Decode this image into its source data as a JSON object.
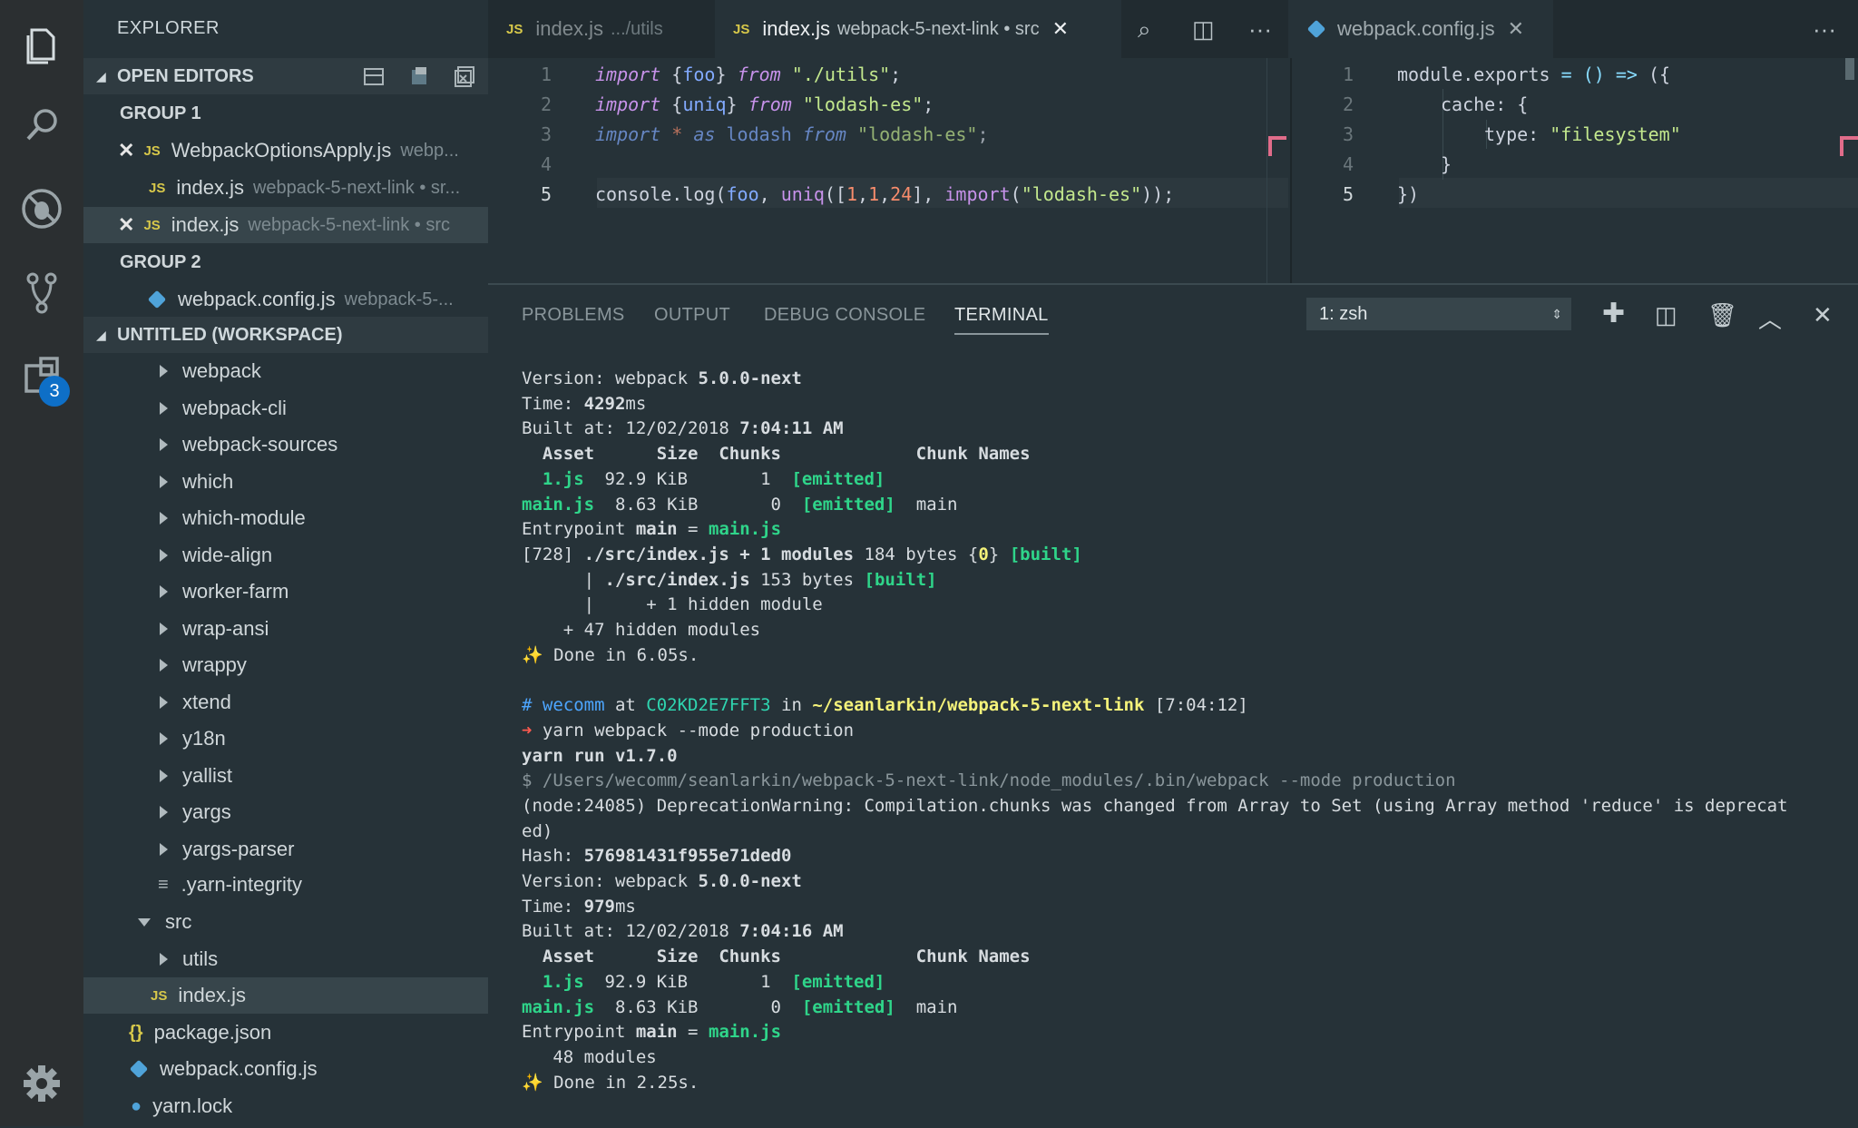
{
  "activity": {
    "badge": "3"
  },
  "sidebar": {
    "title": "EXPLORER",
    "open_editors_label": "OPEN EDITORS",
    "group1": "GROUP 1",
    "group2": "GROUP 2",
    "open_editors": [
      {
        "name": "WebpackOptionsApply.js",
        "desc": "webp..."
      },
      {
        "name": "index.js",
        "desc": "webpack-5-next-link • sr..."
      },
      {
        "name": "index.js",
        "desc": "webpack-5-next-link • src"
      },
      {
        "name": "webpack.config.js",
        "desc": "webpack-5-..."
      }
    ],
    "workspace_label": "UNTITLED (WORKSPACE)",
    "tree": [
      "webpack",
      "webpack-cli",
      "webpack-sources",
      "which",
      "which-module",
      "wide-align",
      "worker-farm",
      "wrap-ansi",
      "wrappy",
      "xtend",
      "y18n",
      "yallist",
      "yargs",
      "yargs-parser"
    ],
    "yarn_integrity": ".yarn-integrity",
    "src": "src",
    "utils": "utils",
    "index": "index.js",
    "package_json": "package.json",
    "webpack_config": "webpack.config.js",
    "yarn_lock": "yarn.lock"
  },
  "tabs": {
    "tab1_name": "index.js",
    "tab1_desc": ".../utils",
    "tab2_name": "index.js",
    "tab2_desc": "webpack-5-next-link • src",
    "tab3_name": "webpack.config.js"
  },
  "editor1": {
    "line_numbers": [
      "1",
      "2",
      "3",
      "4",
      "5"
    ],
    "l1": {
      "kw1": "import",
      "p1": " {",
      "v": "foo",
      "p2": "} ",
      "kw2": "from",
      "s": " \"./utils\"",
      "end": ";"
    },
    "l2": {
      "kw1": "import",
      "p1": " {",
      "v": "uniq",
      "p2": "} ",
      "kw2": "from",
      "s": " \"lodash-es\"",
      "end": ";"
    },
    "l3": {
      "kw1": "import",
      "op": " * ",
      "kw2": "as",
      "v": " lodash ",
      "kw3": "from",
      "s": " \"lodash-es\"",
      "end": ";"
    },
    "l5": {
      "a": "console.log(",
      "foo": "foo",
      "c1": ", ",
      "uniq": "uniq",
      "b1": "([",
      "n1": "1",
      "c2": ",",
      "n2": "1",
      "c3": ",",
      "n3": "24",
      "b2": "], ",
      "imp": "import",
      "b3": "(",
      "s": "\"lodash-es\"",
      "b4": "));"
    }
  },
  "editor2": {
    "line_numbers": [
      "1",
      "2",
      "3",
      "4",
      "5"
    ],
    "l1": {
      "a": "module.exports",
      "op": " = () => ",
      "b": "({"
    },
    "l2": "cache: {",
    "l3": {
      "k": "type: ",
      "s": "\"filesystem\""
    },
    "l4": "}",
    "l5": "})"
  },
  "panel": {
    "tabs": [
      "PROBLEMS",
      "OUTPUT",
      "DEBUG CONSOLE",
      "TERMINAL"
    ],
    "terminal_select": "1: zsh"
  },
  "terminal": {
    "version_label": "Version: webpack ",
    "version": "5.0.0-next",
    "time_label": "Time: ",
    "time1": "4292",
    "ms": "ms",
    "built1_label": "Built at: 12/02/2018 ",
    "built1": "7:04:11 AM",
    "asset_header": "  Asset      Size  Chunks             Chunk Names",
    "r1_name": "  1.js",
    "r1_rest": "  92.9 KiB       1  ",
    "emitted": "[emitted]",
    "r2_name": "main.js",
    "r2_rest": "  8.63 KiB       0  ",
    "r2_chunk": "  main",
    "entry_label": "Entrypoint ",
    "entry_main": "main",
    "entry_eq": " = ",
    "entry_file": "main.js",
    "m1a": "[728] ",
    "m1b": "./src/index.js + 1 modules",
    "m1c": " 184 bytes {",
    "m1d": "0",
    "m1e": "} ",
    "built_tag": "[built]",
    "m2a": "      | ",
    "m2b": "./src/index.js",
    "m2c": " 153 bytes ",
    "m3": "      |     + 1 hidden module",
    "m4": "    + 47 hidden modules",
    "done1": " Done in 6.05s.",
    "p_hash": "# ",
    "p_user": "wecomm",
    "p_at": " at ",
    "p_host": "C02KD2E7FFT3",
    "p_in": " in ",
    "p_path": "~/seanlarkin/webpack-5-next-link",
    "p_time": " [7:04:12]",
    "arrow": "➜ ",
    "cmd": "yarn webpack --mode production",
    "yarn_run": "yarn run v1.7.0",
    "exec": "$ /Users/wecomm/seanlarkin/webpack-5-next-link/node_modules/.bin/webpack --mode production",
    "warn1": "(node:24085) DeprecationWarning: Compilation.chunks was changed from Array to Set (using Array method 'reduce' is deprecat",
    "warn2": "ed)",
    "hash_label": "Hash: ",
    "hash": "576981431f955e71ded0",
    "time2": "979",
    "built2": "7:04:16 AM",
    "modules48": "   48 modules",
    "done2": " Done in 2.25s."
  }
}
